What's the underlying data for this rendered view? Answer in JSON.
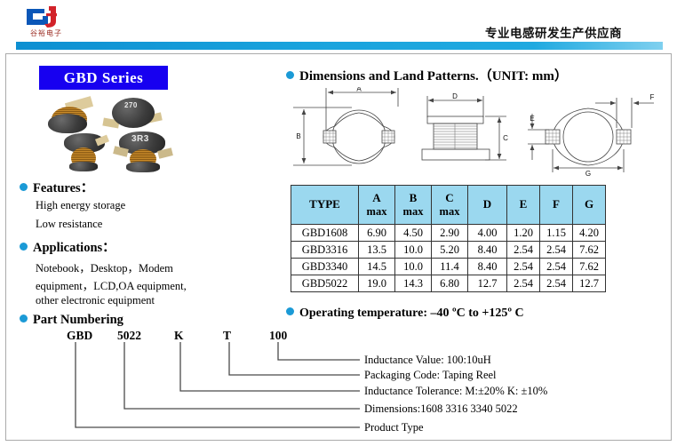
{
  "header": {
    "logo_text": "谷裕电子",
    "slogan": "专业电感研发生产供应商"
  },
  "series": {
    "title": "GBD   Series"
  },
  "photo": {
    "label_top": "270",
    "label_bottom": "3R3"
  },
  "features": {
    "heading": "Features：",
    "lines": [
      "High energy storage",
      "Low resistance"
    ]
  },
  "applications": {
    "heading": "Applications：",
    "lines": [
      "Notebook，Desktop，Modem",
      "equipment，LCD,OA equipment,",
      "other electronic equipment"
    ]
  },
  "dimensions": {
    "heading": "Dimensions and Land Patterns.（UNIT: mm）",
    "drawing_labels": [
      "A",
      "B",
      "C",
      "D",
      "E",
      "F",
      "G"
    ]
  },
  "table": {
    "headers": [
      {
        "main": "TYPE",
        "sub": ""
      },
      {
        "main": "A",
        "sub": "max"
      },
      {
        "main": "B",
        "sub": "max"
      },
      {
        "main": "C",
        "sub": "max"
      },
      {
        "main": "D",
        "sub": ""
      },
      {
        "main": "E",
        "sub": ""
      },
      {
        "main": "F",
        "sub": ""
      },
      {
        "main": "G",
        "sub": ""
      }
    ],
    "rows": [
      [
        "GBD1608",
        "6.90",
        "4.50",
        "2.90",
        "4.00",
        "1.20",
        "1.15",
        "4.20"
      ],
      [
        "GBD3316",
        "13.5",
        "10.0",
        "5.20",
        "8.40",
        "2.54",
        "2.54",
        "7.62"
      ],
      [
        "GBD3340",
        "14.5",
        "10.0",
        "11.4",
        "8.40",
        "2.54",
        "2.54",
        "7.62"
      ],
      [
        "GBD5022",
        "19.0",
        "14.3",
        "6.80",
        "12.7",
        "2.54",
        "2.54",
        "12.7"
      ]
    ]
  },
  "operating_temperature": {
    "heading": "Operating temperature: –40 ºC to +125º C"
  },
  "part_numbering": {
    "heading": "Part Numbering",
    "codes": [
      "GBD",
      "5022",
      "K",
      "T",
      "100"
    ],
    "legend": [
      "Inductance Value:   100:10uH",
      "Packaging Code: Taping Reel",
      "Inductance Tolerance: M:±20% K: ±10%",
      "Dimensions:1608 3316 3340 5022",
      "Product Type"
    ]
  },
  "colors": {
    "accent_blue": "#1b9ad6",
    "series_box": "#1700f0",
    "table_header": "#9bd8ef",
    "bar_gradient_start": "#0d8fd1"
  }
}
